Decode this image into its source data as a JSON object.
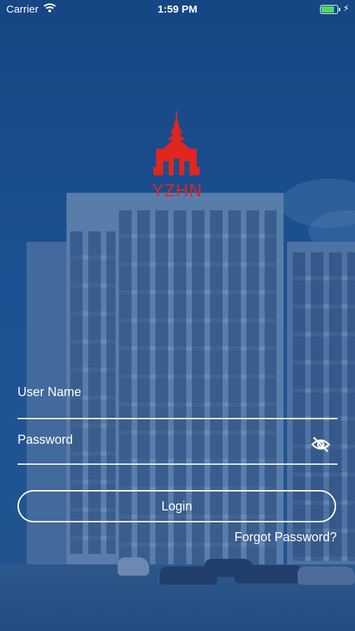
{
  "status_bar": {
    "carrier": "Carrier",
    "time": "1:59 PM"
  },
  "logo": {
    "text": "YZHN",
    "color": "#e0261f"
  },
  "form": {
    "username_label": "User Name",
    "password_label": "Password",
    "login_label": "Login",
    "forgot_label": "Forgot Password?"
  },
  "colors": {
    "background": "#1f4f88",
    "battery": "#4cd964",
    "text": "#ffffff"
  }
}
